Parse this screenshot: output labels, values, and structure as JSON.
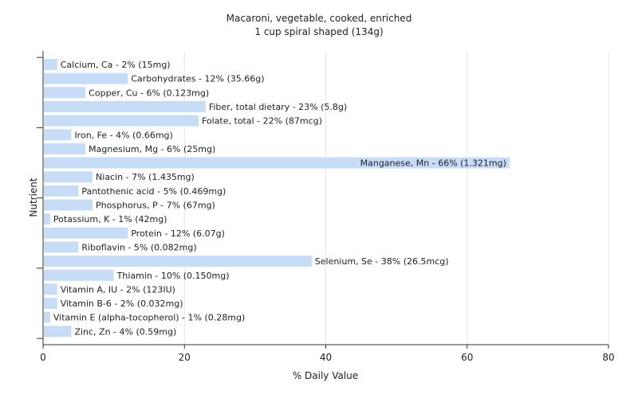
{
  "chart_data": {
    "type": "bar",
    "orientation": "horizontal",
    "title": "Macaroni, vegetable, cooked, enriched",
    "subtitle": "1 cup spiral shaped (134g)",
    "xlabel": "% Daily Value",
    "ylabel": "Nutrient",
    "xlim": [
      0,
      80
    ],
    "xticks": [
      "0",
      "20",
      "40",
      "60",
      "80"
    ],
    "grid": true,
    "bar_color": "#c6dcf7",
    "categories": [
      "Calcium, Ca - 2% (15mg)",
      "Carbohydrates - 12% (35.66g)",
      "Copper, Cu - 6% (0.123mg)",
      "Fiber, total dietary - 23% (5.8g)",
      "Folate, total - 22% (87mcg)",
      "Iron, Fe - 4% (0.66mg)",
      "Magnesium, Mg - 6% (25mg)",
      "Manganese, Mn - 66% (1.321mg)",
      "Niacin - 7% (1.435mg)",
      "Pantothenic acid - 5% (0.469mg)",
      "Phosphorus, P - 7% (67mg)",
      "Potassium, K - 1% (42mg)",
      "Protein - 12% (6.07g)",
      "Riboflavin - 5% (0.082mg)",
      "Selenium, Se - 38% (26.5mcg)",
      "Thiamin - 10% (0.150mg)",
      "Vitamin A, IU - 2% (123IU)",
      "Vitamin B-6 - 2% (0.032mg)",
      "Vitamin E (alpha-tocopherol) - 1% (0.28mg)",
      "Zinc, Zn - 4% (0.59mg)"
    ],
    "values": [
      2,
      12,
      6,
      23,
      22,
      4,
      6,
      66,
      7,
      5,
      7,
      1,
      12,
      5,
      38,
      10,
      2,
      2,
      1,
      4
    ]
  }
}
